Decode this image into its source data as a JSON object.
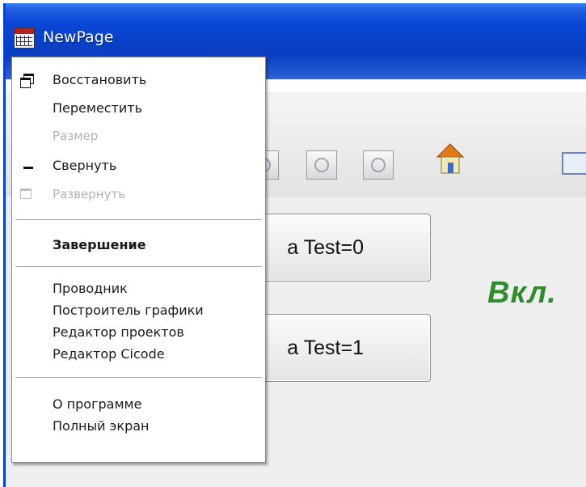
{
  "window": {
    "title": "NewPage"
  },
  "system_menu": {
    "items": [
      {
        "label": "Восстановить",
        "enabled": true,
        "icon": "restore-icon"
      },
      {
        "label": "Переместить",
        "enabled": true
      },
      {
        "label": "Размер",
        "enabled": false
      },
      {
        "label": "Свернуть",
        "enabled": true,
        "icon": "minimize-icon"
      },
      {
        "label": "Развернуть",
        "enabled": false,
        "icon": "maximize-icon"
      },
      {
        "label": "Завершение",
        "enabled": true,
        "bold": true
      },
      {
        "label": "Проводник",
        "enabled": true
      },
      {
        "label": "Построитель графики",
        "enabled": true
      },
      {
        "label": "Редактор проектов",
        "enabled": true
      },
      {
        "label": "Редактор Cicode",
        "enabled": true
      },
      {
        "label": "О программе",
        "enabled": true
      },
      {
        "label": "Полный экран",
        "enabled": true
      }
    ]
  },
  "page": {
    "button_0_label": "a Test=0",
    "button_1_label": "a Test=1",
    "status_text": "Вкл.",
    "status_color": "#2e8b2e"
  },
  "colors": {
    "titlebar": "#0a47d6",
    "menu_background": "#ffffff",
    "disabled_text": "#b2b2b2"
  }
}
